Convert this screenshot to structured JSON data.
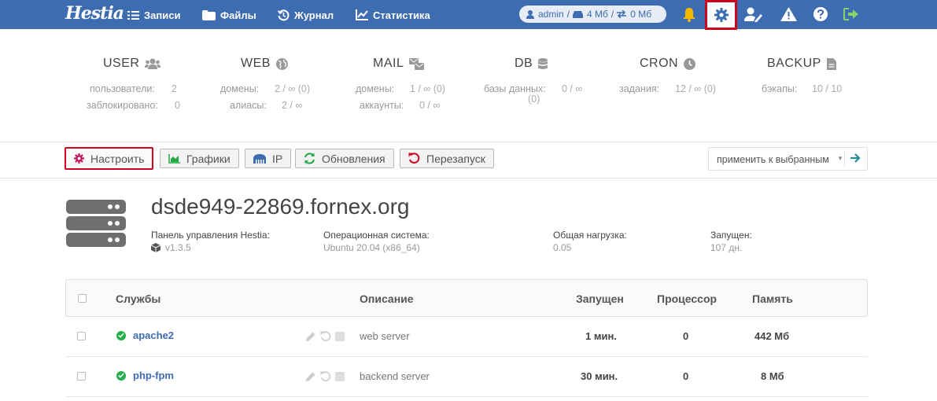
{
  "nav": {
    "logo": "Hestia",
    "items": [
      {
        "label": "Записи",
        "icon": "list-icon"
      },
      {
        "label": "Файлы",
        "icon": "folder-icon"
      },
      {
        "label": "Журнал",
        "icon": "history-icon"
      },
      {
        "label": "Статистика",
        "icon": "chart-icon"
      }
    ],
    "user": {
      "name": "admin",
      "disk_sep": "/",
      "disk": "4 Мб",
      "bandwidth_sep": "/",
      "bandwidth": "0 Мб"
    },
    "colors": {
      "bar": "#3d6cb0",
      "bell": "#f5b800",
      "logout": "#8bd16b",
      "highlight": "#d0021b"
    }
  },
  "stats": [
    {
      "title": "USER",
      "icon": "users-icon",
      "rows": [
        {
          "label": "пользователи:",
          "value": "2"
        },
        {
          "label": "заблокировано:",
          "value": "0"
        }
      ]
    },
    {
      "title": "WEB",
      "icon": "globe-icon",
      "rows": [
        {
          "label": "домены:",
          "value": "2 / ∞ (0)"
        },
        {
          "label": "алиасы:",
          "value": "2 / ∞"
        }
      ]
    },
    {
      "title": "MAIL",
      "icon": "mail-icon",
      "rows": [
        {
          "label": "домены:",
          "value": "1 / ∞ (0)"
        },
        {
          "label": "аккаунты:",
          "value": "0 / ∞"
        }
      ]
    },
    {
      "title": "DB",
      "icon": "database-icon",
      "rows": [
        {
          "label": "базы данных:",
          "value": "0 / ∞",
          "extra": "(0)"
        }
      ]
    },
    {
      "title": "CRON",
      "icon": "clock-icon",
      "rows": [
        {
          "label": "задания:",
          "value": "12 / ∞ (0)"
        }
      ]
    },
    {
      "title": "BACKUP",
      "icon": "file-icon",
      "rows": [
        {
          "label": "бэкапы:",
          "value": "10 / 10"
        }
      ]
    }
  ],
  "toolbar": {
    "buttons": [
      {
        "label": "Настроить",
        "icon": "cog-icon",
        "active": true
      },
      {
        "label": "Графики",
        "icon": "area-chart-icon"
      },
      {
        "label": "IP",
        "icon": "ethernet-icon"
      },
      {
        "label": "Обновления",
        "icon": "sync-icon"
      },
      {
        "label": "Перезапуск",
        "icon": "restart-icon"
      }
    ],
    "apply_label": "применить к выбранным"
  },
  "server": {
    "hostname": "dsde949-22869.fornex.org",
    "panel_label": "Панель управления Hestia:",
    "panel_value": "v1.3.5",
    "os_label": "Операционная система:",
    "os_value": "Ubuntu 20.04 (x86_64)",
    "load_label": "Общая нагрузка:",
    "load_value": "0.05",
    "uptime_label": "Запущен:",
    "uptime_value": "107 дн."
  },
  "table": {
    "headers": {
      "service": "Службы",
      "description": "Описание",
      "uptime": "Запущен",
      "cpu": "Процессор",
      "memory": "Память"
    },
    "rows": [
      {
        "name": "apache2",
        "description": "web server",
        "uptime": "1 мин.",
        "cpu": "0",
        "memory": "442 Мб"
      },
      {
        "name": "php-fpm",
        "description": "backend server",
        "uptime": "30 мин.",
        "cpu": "0",
        "memory": "8 Мб"
      }
    ]
  }
}
